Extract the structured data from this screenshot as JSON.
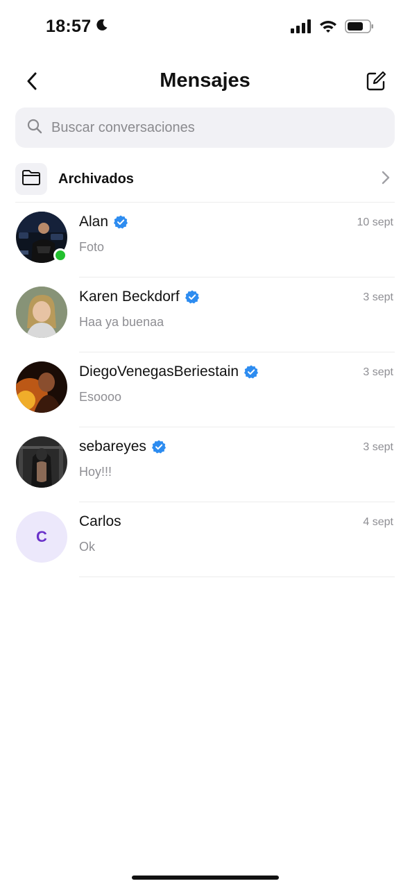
{
  "status_bar": {
    "time": "18:57",
    "icons": [
      "moon-icon",
      "cellular-signal-icon",
      "wifi-icon",
      "battery-icon"
    ]
  },
  "header": {
    "title": "Mensajes",
    "back_icon": "chevron-left-icon",
    "compose_icon": "compose-icon"
  },
  "search": {
    "placeholder": "Buscar conversaciones",
    "value": "",
    "icon": "search-icon"
  },
  "archived": {
    "label": "Archivados",
    "icon": "folder-icon",
    "chevron_icon": "chevron-right-icon"
  },
  "conversations": [
    {
      "name": "Alan",
      "verified": true,
      "date": "10 sept",
      "preview": "Foto",
      "online": true,
      "avatar": "photo"
    },
    {
      "name": "Karen Beckdorf",
      "verified": true,
      "date": "3 sept",
      "preview": "Haa ya buenaa",
      "online": false,
      "avatar": "photo"
    },
    {
      "name": "DiegoVenegasBeriestain",
      "verified": true,
      "date": "3 sept",
      "preview": "Esoooo",
      "online": false,
      "avatar": "photo"
    },
    {
      "name": "sebareyes",
      "verified": true,
      "date": "3 sept",
      "preview": "Hoy!!!",
      "online": false,
      "avatar": "photo"
    },
    {
      "name": "Carlos",
      "verified": false,
      "date": "4 sept",
      "preview": "Ok",
      "online": false,
      "avatar": "initial",
      "initial": "C"
    }
  ],
  "colors": {
    "verified_blue": "#2d8cf0",
    "online_green": "#22c02e",
    "search_bg": "#f1f1f5",
    "secondary_text": "#8e8e93",
    "initial_avatar_bg": "#ece8fb",
    "initial_avatar_text": "#6a32c9"
  }
}
